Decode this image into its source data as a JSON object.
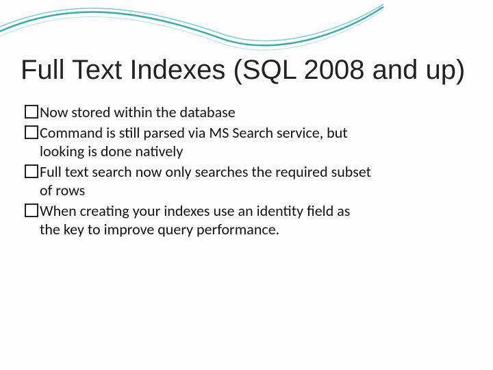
{
  "title": "Full Text Indexes (SQL 2008 and up)",
  "bullets": [
    {
      "first": "Now stored within the database",
      "rest": []
    },
    {
      "first": "Command is still parsed via MS Search service, but",
      "rest": [
        "looking is done natively"
      ]
    },
    {
      "first": "Full text search now only searches the required subset",
      "rest": [
        "of rows"
      ]
    },
    {
      "first": "When creating your indexes use an identity field as",
      "rest": [
        "the key to improve query performance."
      ]
    }
  ]
}
